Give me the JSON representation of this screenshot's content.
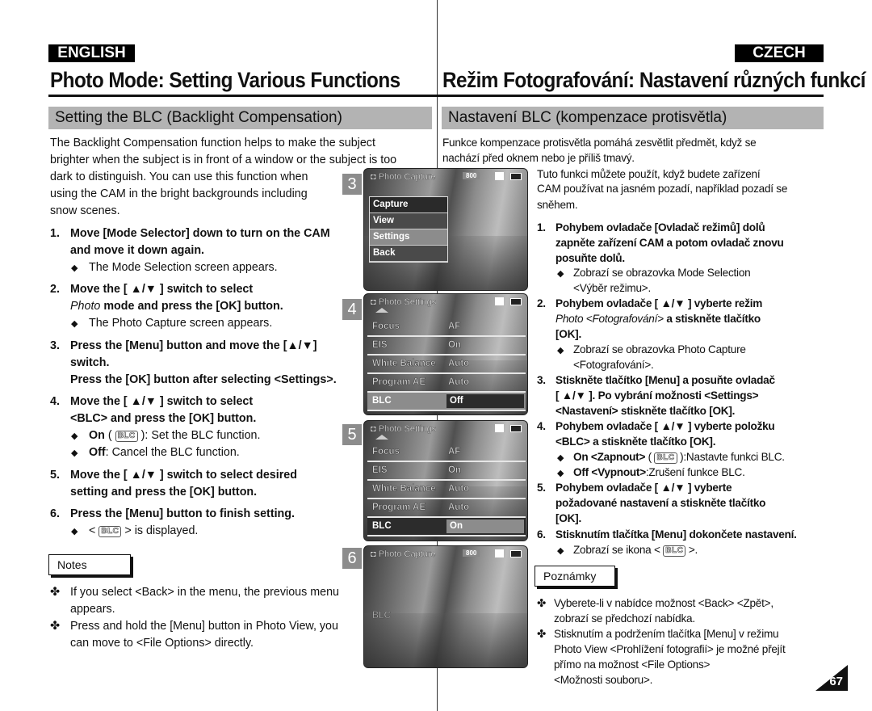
{
  "header": {
    "english_badge": "ENGLISH",
    "czech_badge": "CZECH",
    "english_title": "Photo Mode: Setting Various Functions",
    "czech_title": "Režim Fotografování: Nastavení různých funkcí"
  },
  "english": {
    "section_title": "Setting the BLC (Backlight Compensation)",
    "intro": [
      "The Backlight Compensation function helps to make the subject",
      "brighter when the subject is in front of a window or the subject is too",
      "dark to distinguish. You can use this function when",
      "using the CAM in the bright backgrounds including",
      "snow scenes."
    ],
    "steps": [
      {
        "num": "1.",
        "lines": [
          "Move [Mode Selector] down to turn on the CAM",
          "and move it down again."
        ],
        "bullet": "The Mode Selection screen appears."
      },
      {
        "num": "2.",
        "lines": [
          "Move the [ ▲/▼ ] switch to select",
          " mode and press the [OK] button."
        ],
        "italic": "Photo",
        "bullet": "The Photo Capture screen appears."
      },
      {
        "num": "3.",
        "lines": [
          "Press the [Menu] button and move the  [▲/▼]",
          "switch.",
          "Press the [OK] button after selecting <Settings>."
        ]
      },
      {
        "num": "4.",
        "lines": [
          "Move the [ ▲/▼ ] switch to select",
          "<BLC> and press the [OK] button."
        ],
        "bullet_on_bold": "On",
        "bullet_on_rest": "): Set the BLC function.",
        "bullet_off_bold": "Off",
        "bullet_off_rest": ": Cancel the BLC function."
      },
      {
        "num": "5.",
        "lines": [
          "Move the [ ▲/▼ ] switch to select desired",
          "setting and press the [OK] button."
        ]
      },
      {
        "num": "6.",
        "lines": [
          "Press the [Menu] button to finish setting."
        ],
        "bullet_pre": "<",
        "bullet_post": "> is displayed."
      }
    ],
    "notes_label": "Notes",
    "notes": [
      [
        "If you select <Back> in the menu, the previous menu",
        "appears."
      ],
      [
        "Press and hold the [Menu] button in Photo View, you",
        "can move to <File Options> directly."
      ]
    ]
  },
  "czech": {
    "section_title": "Nastavení BLC (kompenzace protisvětla)",
    "intro": [
      "Funkce kompenzace protisvětla pomáhá zesvětlit předmět, když se",
      "nachází před oknem nebo je příliš tmavý.",
      "Tuto funkci můžete použít, když budete zařízení",
      "CAM používat na jasném pozadí, například pozadí se",
      "sněhem."
    ],
    "steps": [
      {
        "num": "1.",
        "lines": [
          "Pohybem ovladače [Ovladač režimů] dolů",
          "zapněte zařízení CAM a potom ovladač znovu",
          "posuňte dolů."
        ],
        "bullet": [
          "Zobrazí se obrazovka Mode Selection",
          "<Výběr režimu>."
        ]
      },
      {
        "num": "2.",
        "lines": [
          "Pohybem ovladače [ ▲/▼ ] vyberte režim",
          " a stiskněte tlačítko",
          "[OK]."
        ],
        "italic": "Photo <Fotografování>",
        "bullet": [
          "Zobrazí se obrazovka Photo Capture",
          "<Fotografování>."
        ]
      },
      {
        "num": "3.",
        "lines": [
          "Stiskněte tlačítko [Menu] a posuňte ovladač",
          "[ ▲/▼ ]. Po vybrání možnosti <Settings>",
          "<Nastavení> stiskněte tlačítko [OK]."
        ]
      },
      {
        "num": "4.",
        "lines": [
          "Pohybem ovladače [ ▲/▼ ] vyberte položku",
          "<BLC> a stiskněte tlačítko [OK]."
        ],
        "bullet_on_bold": "On <Zapnout>",
        "bullet_on_rest": "):Nastavte funkci BLC.",
        "bullet_off_bold": "Off <Vypnout>",
        "bullet_off_rest": ":Zrušení funkce BLC."
      },
      {
        "num": "5.",
        "lines": [
          "Pohybem ovladače [ ▲/▼ ] vyberte",
          "požadované nastavení a stiskněte tlačítko",
          "[OK]."
        ]
      },
      {
        "num": "6.",
        "lines": [
          "Stisknutím tlačítka [Menu] dokončete nastavení."
        ],
        "bullet_pre": "Zobrazí se ikona <",
        "bullet_post": ">."
      }
    ],
    "notes_label": "Poznámky",
    "notes": [
      [
        "Vyberete-li v nabídce možnost <Back> <Zpět>,",
        "zobrazí se předchozí nabídka."
      ],
      [
        "Stisknutím a podržením tlačítka [Menu] v režimu",
        "Photo View <Prohlížení fotografií> je možné přejít",
        "přímo na možnost <File Options>",
        "<Možnosti souboru>."
      ]
    ]
  },
  "icons": {
    "bullet": "◆",
    "note": "✤",
    "blc": "BLC"
  },
  "screens": [
    {
      "num": "3",
      "title": "Photo Capture",
      "count": "800",
      "menu": [
        "Capture",
        "View",
        "Settings",
        "Back"
      ],
      "selected": "Settings"
    },
    {
      "num": "4",
      "title": "Photo Settings",
      "rows": [
        [
          "Focus",
          "AF"
        ],
        [
          "EIS",
          "On"
        ],
        [
          "White Balance",
          "Auto"
        ],
        [
          "Program AE",
          "Auto"
        ],
        [
          "BLC",
          "Off"
        ]
      ]
    },
    {
      "num": "5",
      "title": "Photo Settings",
      "rows": [
        [
          "Focus",
          "AF"
        ],
        [
          "EIS",
          "On"
        ],
        [
          "White Balance",
          "Auto"
        ],
        [
          "Program AE",
          "Auto"
        ],
        [
          "BLC",
          "On"
        ]
      ]
    },
    {
      "num": "6",
      "title": "Photo Capture",
      "count": "800",
      "overlay": "BLC"
    }
  ],
  "page_number": "67"
}
